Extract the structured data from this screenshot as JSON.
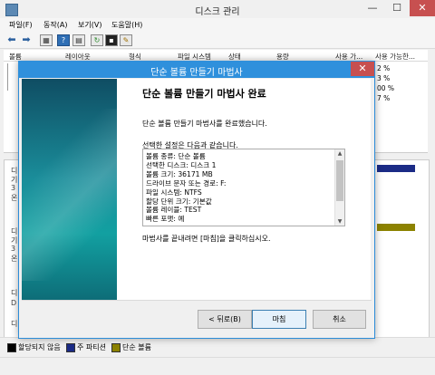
{
  "window": {
    "title": "디스크 관리",
    "minimize": "—",
    "maximize": "☐",
    "close": "✕"
  },
  "menu": [
    "파일(F)",
    "동작(A)",
    "보기(V)",
    "도움말(H)"
  ],
  "toolbar_icons": [
    "back-arrow-icon",
    "forward-arrow-icon",
    "grid-icon",
    "help-icon",
    "view-icon",
    "refresh-icon",
    "properties-icon",
    "settings-icon"
  ],
  "volume_table": {
    "columns": [
      "볼륨",
      "레이아웃",
      "형식",
      "파일 시스템",
      "상태",
      "용량",
      "사용 가...",
      "사용 가능한..."
    ],
    "percents": [
      "2 %",
      "3 %",
      "00 %",
      "7 %"
    ]
  },
  "lower_hints": [
    "디",
    "기",
    "3",
    "온",
    "디",
    "기",
    "3",
    "온",
    "디",
    "D",
    "디"
  ],
  "legend": [
    {
      "label": "할당되지 않음",
      "color": "#000000"
    },
    {
      "label": "주 파티션",
      "color": "#1b2b86"
    },
    {
      "label": "단순 볼륨",
      "color": "#8c8200"
    }
  ],
  "wizard": {
    "title": "단순 볼륨 만들기 마법사",
    "close": "✕",
    "heading": "단순 볼륨 만들기 마법사 완료",
    "intro": "단순 볼륨 만들기 마법사를 완료했습니다.",
    "settings_label": "선택한 설정은 다음과 같습니다.",
    "summary": [
      "볼륨 종류: 단순 볼륨",
      "선택한 디스크: 디스크 1",
      "볼륨 크기: 36171 MB",
      "드라이브 문자 또는 경로: F:",
      "파일 시스템: NTFS",
      "할당 단위 크기: 기본값",
      "볼륨 레이블: TEST",
      "빠른 포맷: 예"
    ],
    "closing_text": "마법사를 끝내려면 [마침]을 클릭하십시오.",
    "buttons": {
      "back": "< 뒤로(B)",
      "finish": "마침",
      "cancel": "취소"
    }
  }
}
